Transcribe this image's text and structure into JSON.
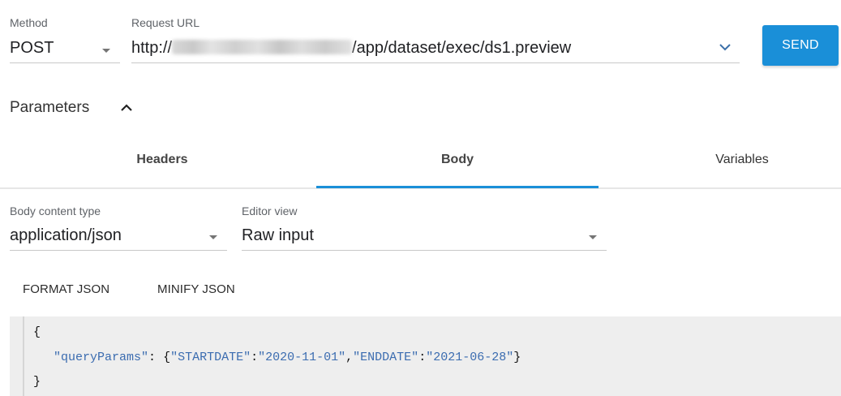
{
  "request": {
    "method_label": "Method",
    "method_value": "POST",
    "url_label": "Request URL",
    "url_prefix": "http://",
    "url_suffix": "/app/dataset/exec/ds1.preview",
    "send_label": "SEND"
  },
  "parameters": {
    "title": "Parameters"
  },
  "tabs": [
    {
      "label": "Headers",
      "active": false
    },
    {
      "label": "Body",
      "active": true
    },
    {
      "label": "Variables",
      "active": false
    }
  ],
  "body": {
    "content_type_label": "Body content type",
    "content_type_value": "application/json",
    "editor_view_label": "Editor view",
    "editor_view_value": "Raw input",
    "format_json_label": "FORMAT JSON",
    "minify_json_label": "MINIFY JSON"
  },
  "code": {
    "open": "{",
    "key": "\"queryParams\"",
    "colon": ":",
    "obj_open": "{",
    "k1": "\"STARTDATE\"",
    "v1": "\"2020-11-01\"",
    "comma": ",",
    "k2": "\"ENDDATE\"",
    "v2": "\"2021-06-28\"",
    "obj_close": "}",
    "close": "}"
  },
  "colors": {
    "accent": "#1a8fd8",
    "code_bg": "#eeeeee",
    "code_string": "#3b6cb0"
  }
}
